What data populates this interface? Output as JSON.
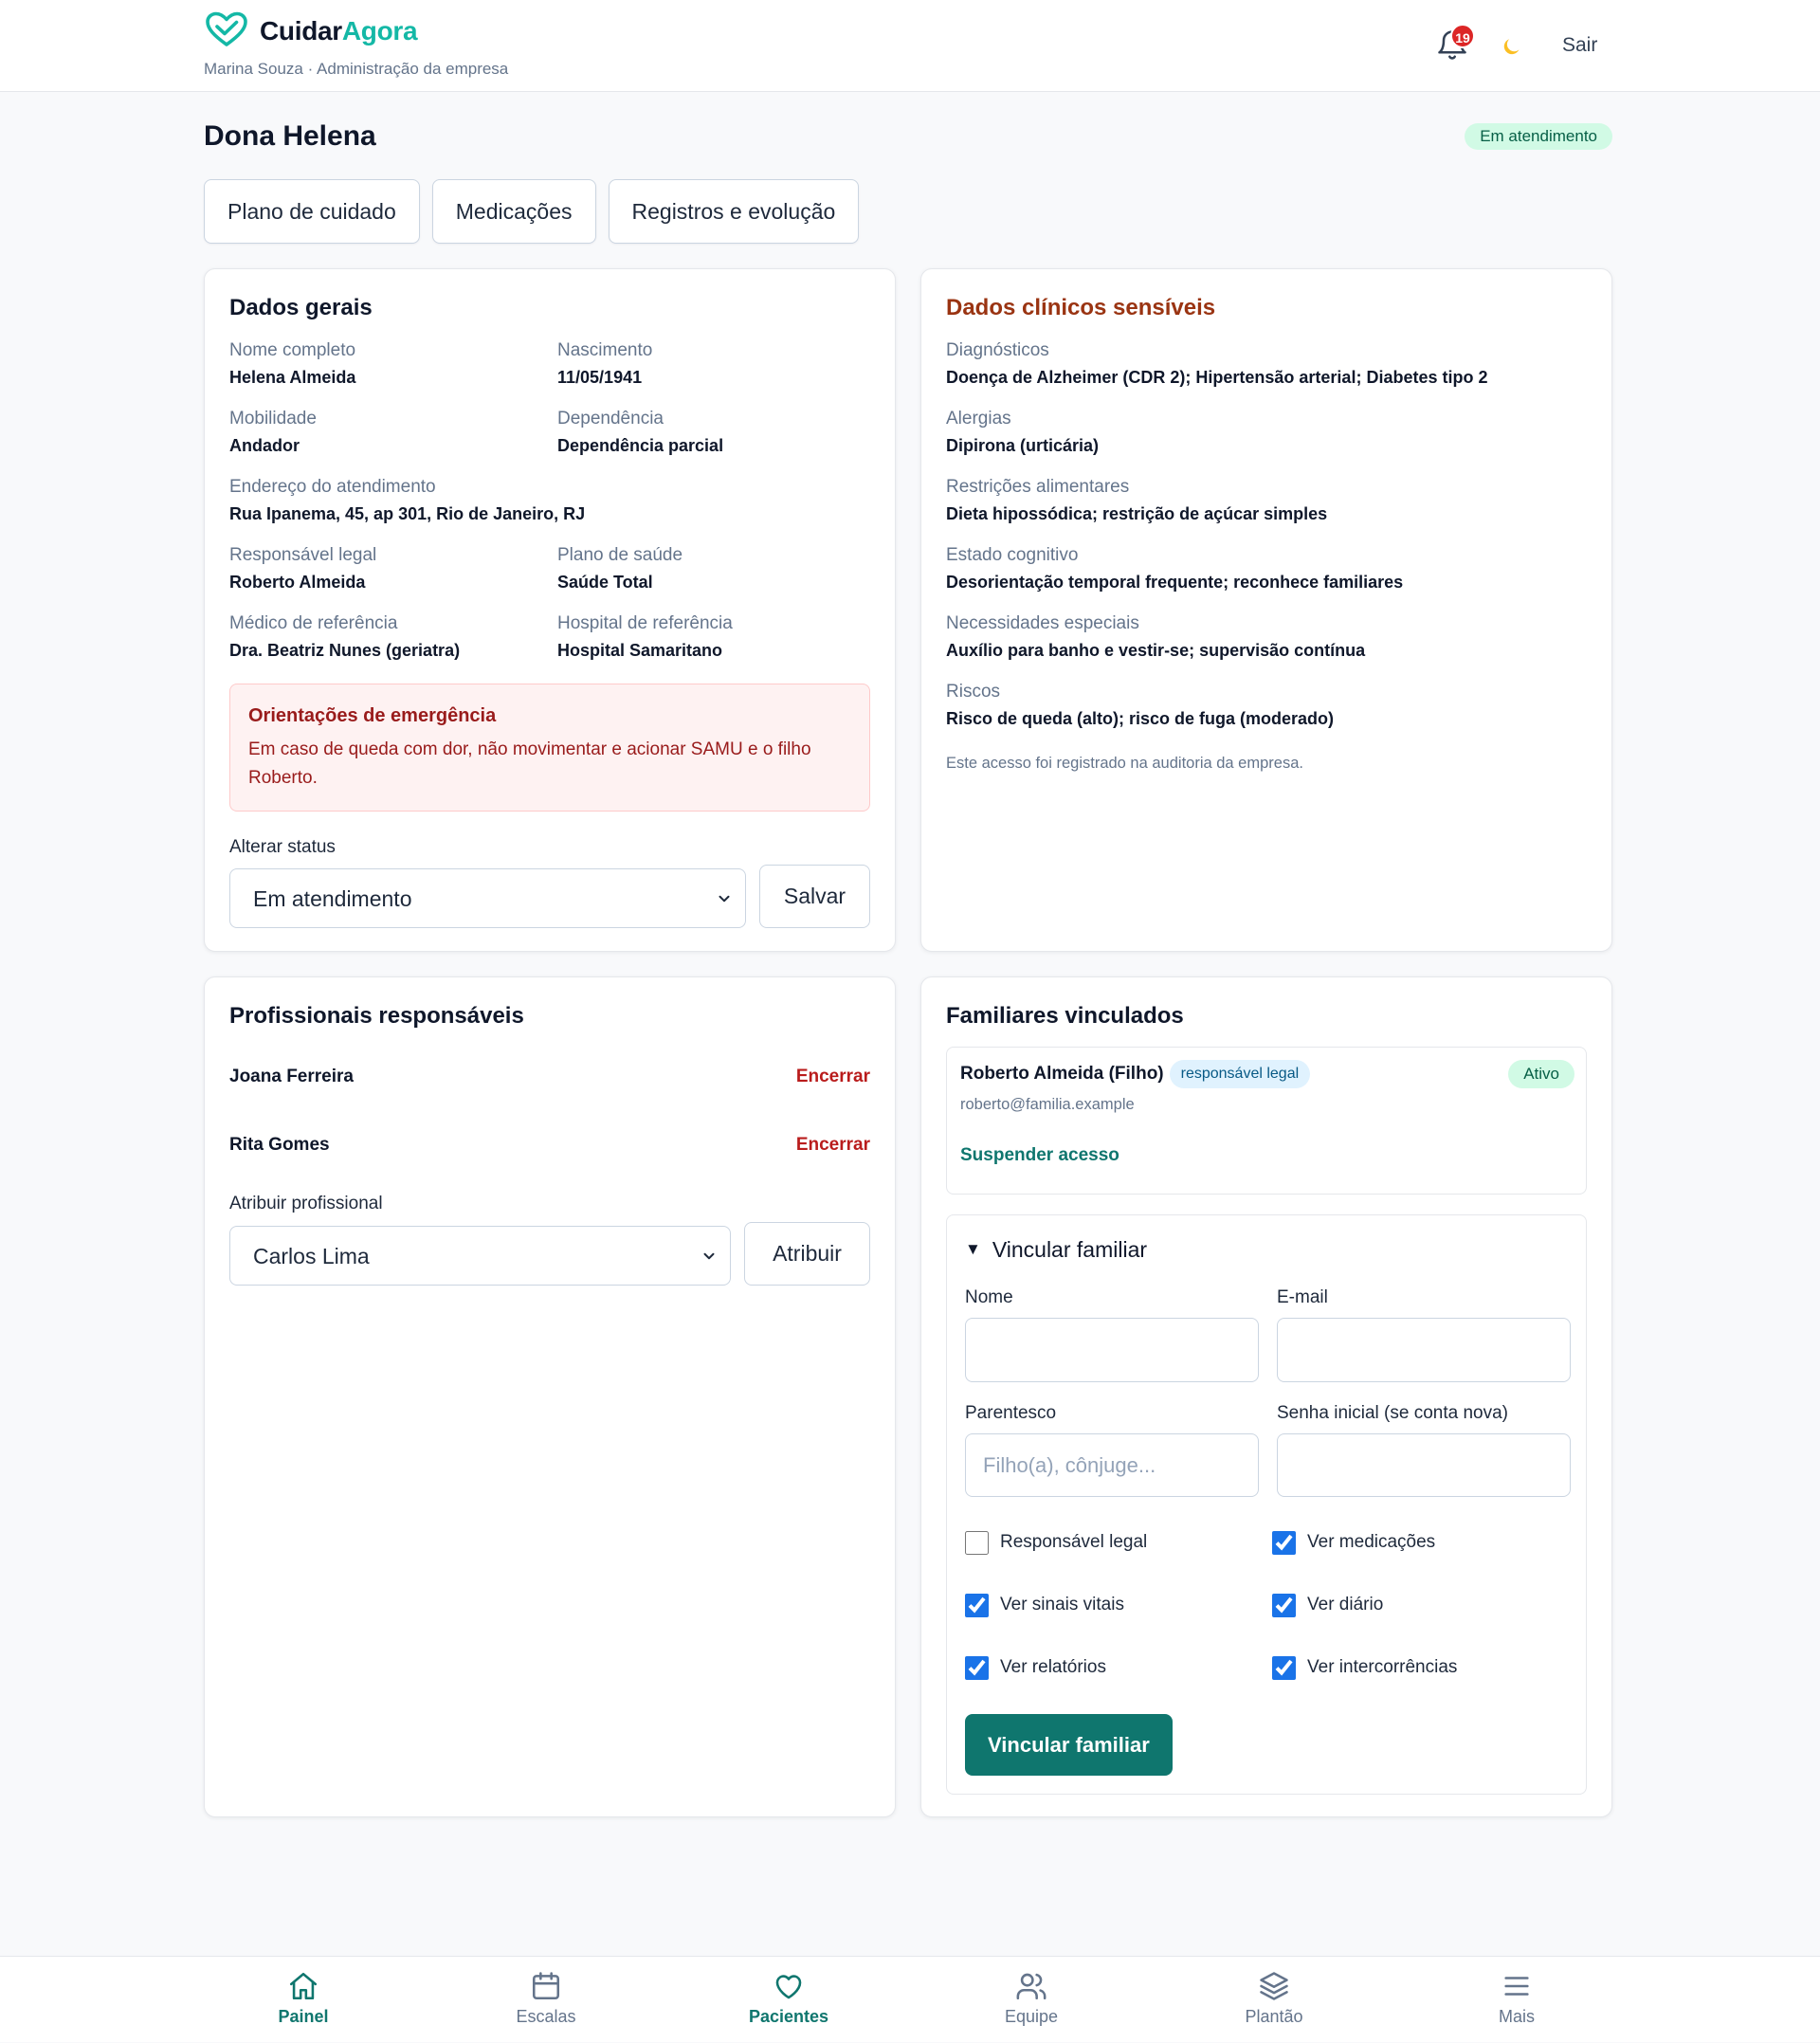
{
  "header": {
    "brand_primary": "Cuidar",
    "brand_accent": "Agora",
    "user_line": "Marina Souza · Administração da empresa",
    "notification_count": "19",
    "logout_label": "Sair",
    "icons": {
      "logo": "heart-logo-icon",
      "notifications": "bell-icon",
      "theme": "moon-icon"
    }
  },
  "patient": {
    "name": "Dona Helena",
    "status": "Em atendimento"
  },
  "tabs": [
    "Plano de cuidado",
    "Medicações",
    "Registros e evolução"
  ],
  "general": {
    "title": "Dados gerais",
    "fields": [
      {
        "label": "Nome completo",
        "value": "Helena Almeida"
      },
      {
        "label": "Nascimento",
        "value": "11/05/1941"
      },
      {
        "label": "Mobilidade",
        "value": "Andador"
      },
      {
        "label": "Dependência",
        "value": "Dependência parcial"
      },
      {
        "label": "Endereço do atendimento",
        "value": "Rua Ipanema, 45, ap 301, Rio de Janeiro, RJ"
      },
      {
        "label": "Responsável legal",
        "value": "Roberto Almeida"
      },
      {
        "label": "Plano de saúde",
        "value": "Saúde Total"
      },
      {
        "label": "Médico de referência",
        "value": "Dra. Beatriz Nunes (geriatra)"
      },
      {
        "label": "Hospital de referência",
        "value": "Hospital Samaritano"
      }
    ],
    "emergency": {
      "title": "Orientações de emergência",
      "text": "Em caso de queda com dor, não movimentar e acionar SAMU e o filho Roberto."
    },
    "status_form": {
      "label": "Alterar status",
      "selected": "Em atendimento",
      "save_label": "Salvar"
    }
  },
  "clinical": {
    "title": "Dados clínicos sensíveis",
    "fields": [
      {
        "label": "Diagnósticos",
        "value": "Doença de Alzheimer (CDR 2); Hipertensão arterial; Diabetes tipo 2"
      },
      {
        "label": "Alergias",
        "value": "Dipirona (urticária)"
      },
      {
        "label": "Restrições alimentares",
        "value": "Dieta hipossódica; restrição de açúcar simples"
      },
      {
        "label": "Estado cognitivo",
        "value": "Desorientação temporal frequente; reconhece familiares"
      },
      {
        "label": "Necessidades especiais",
        "value": "Auxílio para banho e vestir-se; supervisão contínua"
      },
      {
        "label": "Riscos",
        "value": "Risco de queda (alto); risco de fuga (moderado)"
      }
    ],
    "audit_note": "Este acesso foi registrado na auditoria da empresa."
  },
  "professionals": {
    "title": "Profissionais responsáveis",
    "items": [
      {
        "name": "Joana Ferreira",
        "action": "Encerrar"
      },
      {
        "name": "Rita Gomes",
        "action": "Encerrar"
      }
    ],
    "assign_label": "Atribuir profissional",
    "selected": "Carlos Lima",
    "assign_button": "Atribuir"
  },
  "family": {
    "title": "Familiares vinculados",
    "members": [
      {
        "name": "Roberto Almeida (Filho)",
        "role_badge": "responsável legal",
        "status": "Ativo",
        "email": "roberto@familia.example",
        "action": "Suspender acesso"
      }
    ],
    "link_form": {
      "summary": "Vincular familiar",
      "fields": [
        {
          "label": "Nome"
        },
        {
          "label": "E-mail"
        },
        {
          "label": "Parentesco",
          "placeholder": "Filho(a), cônjuge..."
        },
        {
          "label": "Senha inicial (se conta nova)"
        }
      ],
      "permissions": [
        {
          "label": "Responsável legal",
          "checked": false
        },
        {
          "label": "Ver medicações",
          "checked": true
        },
        {
          "label": "Ver sinais vitais",
          "checked": true
        },
        {
          "label": "Ver diário",
          "checked": true
        },
        {
          "label": "Ver relatórios",
          "checked": true
        },
        {
          "label": "Ver intercorrências",
          "checked": true
        }
      ],
      "submit_label": "Vincular familiar"
    }
  },
  "nav": {
    "items": [
      {
        "label": "Painel",
        "icon": "home-icon",
        "highlight": true
      },
      {
        "label": "Escalas",
        "icon": "calendar-icon",
        "highlight": false
      },
      {
        "label": "Pacientes",
        "icon": "heart-icon",
        "highlight": true
      },
      {
        "label": "Equipe",
        "icon": "users-icon",
        "highlight": false
      },
      {
        "label": "Plantão",
        "icon": "layers-icon",
        "highlight": false
      },
      {
        "label": "Mais",
        "icon": "menu-icon",
        "highlight": false
      }
    ]
  },
  "colors": {
    "brand": "#0f766e",
    "brand_light": "#14b8a6",
    "danger": "#b91c1c",
    "clinical_title": "#9a3412",
    "status_badge_bg": "#d1fae5",
    "notification_badge": "#dc2626"
  }
}
